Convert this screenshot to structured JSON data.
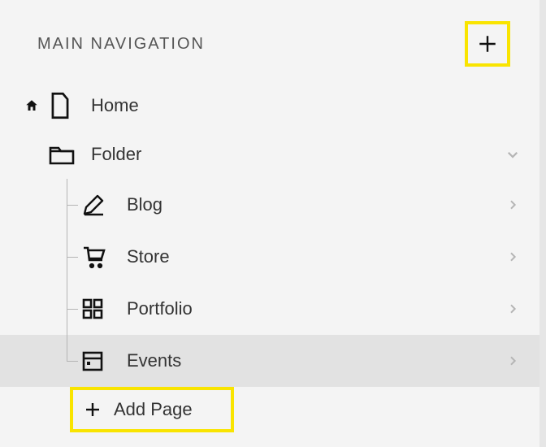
{
  "header": {
    "title": "MAIN NAVIGATION"
  },
  "nav": {
    "home": {
      "label": "Home"
    },
    "folder": {
      "label": "Folder"
    },
    "children": {
      "blog": {
        "label": "Blog"
      },
      "store": {
        "label": "Store"
      },
      "portfolio": {
        "label": "Portfolio"
      },
      "events": {
        "label": "Events"
      }
    },
    "add_page": {
      "label": "Add Page"
    }
  },
  "colors": {
    "highlight": "#f9e400",
    "text": "#333333",
    "muted": "#b5b5b5",
    "panel": "#f4f4f4",
    "active": "#e2e2e2"
  }
}
